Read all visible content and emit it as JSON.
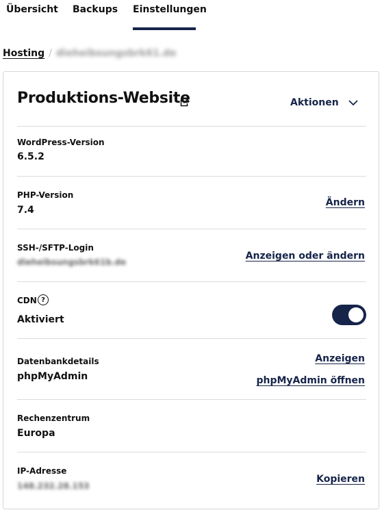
{
  "tabs": [
    {
      "label": "Übersicht"
    },
    {
      "label": "Backups"
    },
    {
      "label": "Einstellungen"
    }
  ],
  "breadcrumb": {
    "root": "Hosting",
    "separator": "/",
    "current": "dieheibsungsbrk61.de"
  },
  "header": {
    "title": "Produktions-Website",
    "actions_label": "Aktionen"
  },
  "rows": {
    "wordpress": {
      "label": "WordPress-Version",
      "value": "6.5.2"
    },
    "php": {
      "label": "PHP-Version",
      "value": "7.4",
      "action": "Ändern"
    },
    "ssh": {
      "label": "SSH-/SFTP-Login",
      "value": "dieheibsungsbrk61b.de",
      "action": "Anzeigen oder ändern"
    },
    "cdn": {
      "label": "CDN",
      "help": "?",
      "value": "Aktiviert",
      "enabled": true
    },
    "database": {
      "label": "Datenbankdetails",
      "value": "phpMyAdmin",
      "action_show": "Anzeigen",
      "action_open": "phpMyAdmin öffnen"
    },
    "datacenter": {
      "label": "Rechenzentrum",
      "value": "Europa"
    },
    "ip": {
      "label": "IP-Adresse",
      "value": "148.232.28.153",
      "action": "Kopieren"
    }
  },
  "colors": {
    "accent": "#16244a",
    "divider": "#dcdcdc",
    "border": "#d6d6d6"
  }
}
